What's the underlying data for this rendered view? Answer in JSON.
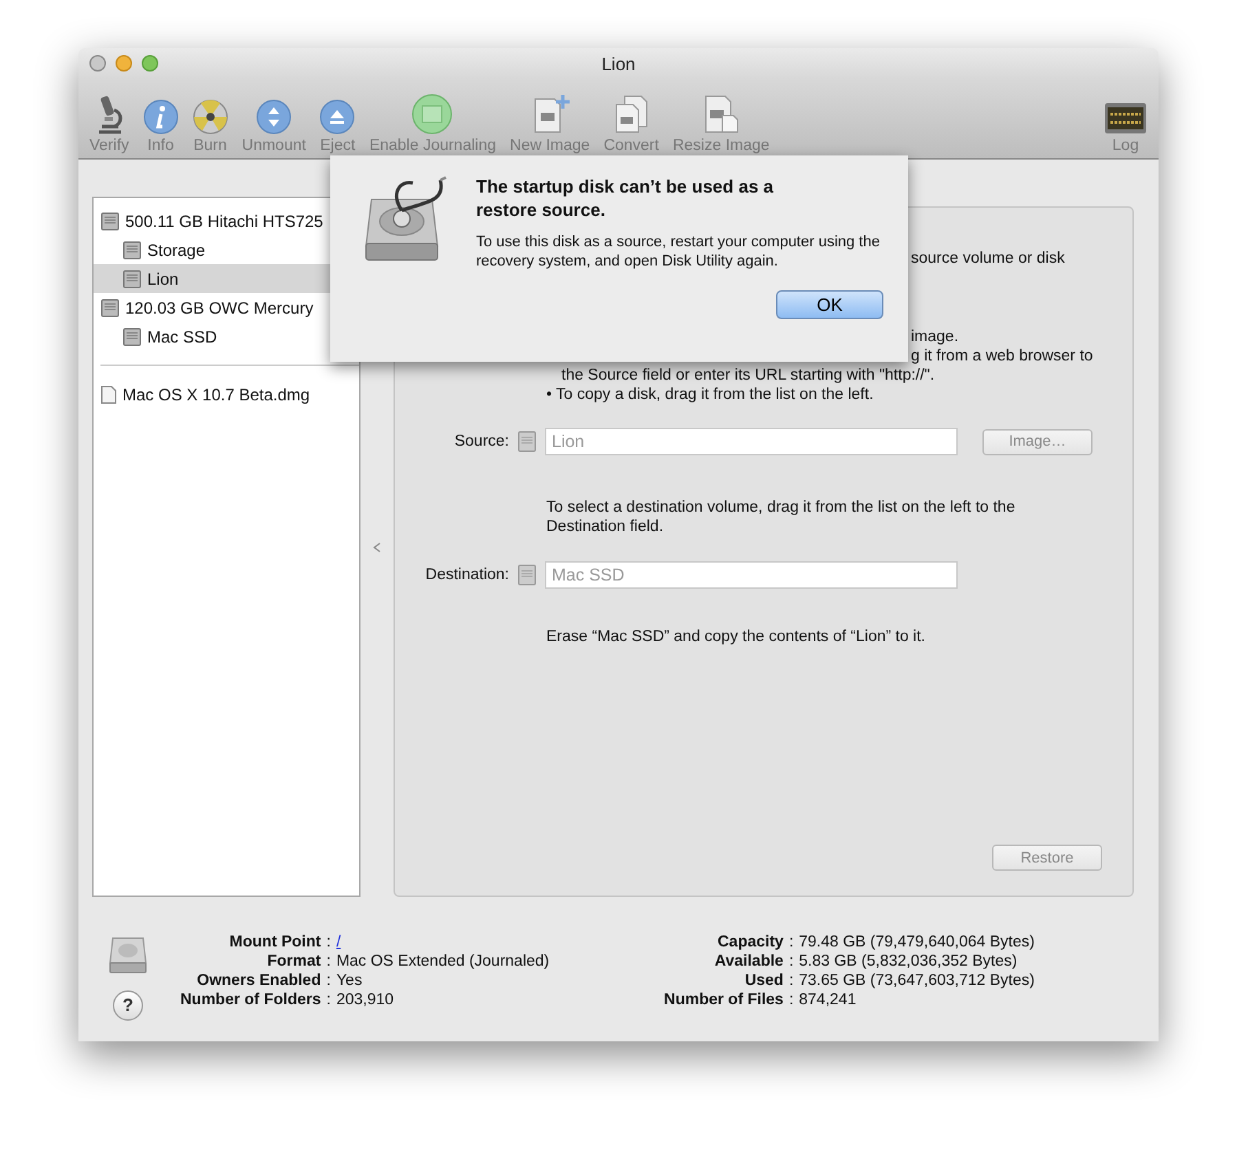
{
  "window": {
    "title": "Lion"
  },
  "toolbar": [
    {
      "kind": "verify",
      "label": "Verify"
    },
    {
      "kind": "info",
      "label": "Info"
    },
    {
      "kind": "burn",
      "label": "Burn"
    },
    {
      "kind": "unmount",
      "label": "Unmount"
    },
    {
      "kind": "eject",
      "label": "Eject"
    },
    {
      "kind": "journal",
      "label": "Enable Journaling"
    },
    {
      "kind": "newimage",
      "label": "New Image"
    },
    {
      "kind": "convert",
      "label": "Convert"
    },
    {
      "kind": "resize",
      "label": "Resize Image"
    },
    {
      "kind": "log",
      "label": "Log"
    }
  ],
  "sidebar": {
    "disks": [
      {
        "label": "500.11 GB Hitachi HTS725",
        "selected": false,
        "children": [
          {
            "label": "Storage",
            "selected": false
          },
          {
            "label": "Lion",
            "selected": true
          }
        ]
      },
      {
        "label": "120.03 GB OWC Mercury",
        "selected": false,
        "children": [
          {
            "label": "Mac SSD",
            "selected": false
          }
        ]
      }
    ],
    "images": [
      {
        "label": "Mac OS X 10.7 Beta.dmg",
        "selected": false
      }
    ]
  },
  "restore": {
    "intro_fragment": "source volume or disk",
    "bullet_fragments": [
      "image.",
      "g it from a web browser to"
    ],
    "bullet_continuation": "the Source field or enter its URL starting with \"http://\".",
    "bullets": [
      "• To copy a disk, drag it from the list on the left."
    ],
    "source": {
      "label": "Source:",
      "value": "Lion",
      "button": "Image…"
    },
    "destination_hint": "To select a destination volume, drag it from the list on the left to the Destination field.",
    "destination": {
      "label": "Destination:",
      "value": "Mac SSD"
    },
    "summary": "Erase “Mac SSD” and copy the contents of “Lion” to it.",
    "button": "Restore"
  },
  "info": {
    "left": [
      {
        "label": "Mount Point",
        "value": "/",
        "kind": "link"
      },
      {
        "label": "Format",
        "value": "Mac OS Extended (Journaled)",
        "kind": "text"
      },
      {
        "label": "Owners Enabled",
        "value": "Yes",
        "kind": "text"
      },
      {
        "label": "Number of Folders",
        "value": "203,910",
        "kind": "text"
      }
    ],
    "right": [
      {
        "label": "Capacity",
        "value": "79.48 GB (79,479,640,064 Bytes)"
      },
      {
        "label": "Available",
        "value": "5.83 GB (5,832,036,352 Bytes)"
      },
      {
        "label": "Used",
        "value": "73.65 GB (73,647,603,712 Bytes)"
      },
      {
        "label": "Number of Files",
        "value": "874,241"
      }
    ],
    "separator": ":",
    "help": "?"
  },
  "sheet": {
    "title": "The startup disk can’t be used as a restore source.",
    "message": "To use this disk as a source, restart your computer using the recovery system, and open Disk Utility again.",
    "button": "OK"
  }
}
